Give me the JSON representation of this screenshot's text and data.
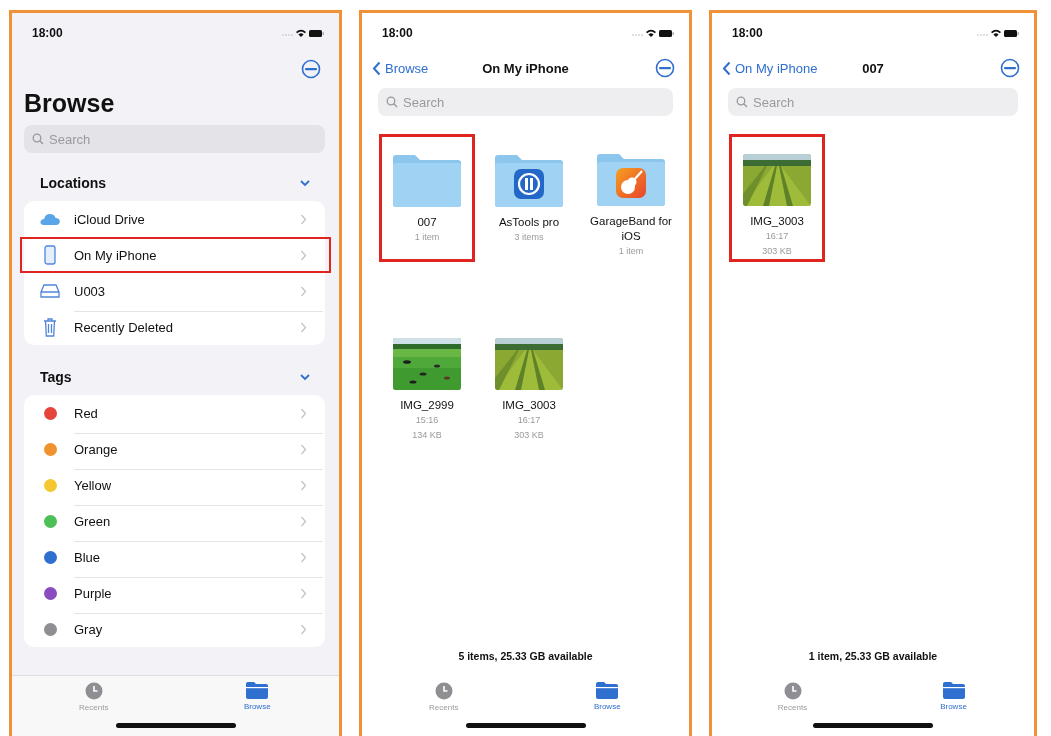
{
  "screens": [
    {
      "kind": "browse",
      "status_bar": {
        "time": "18:00"
      },
      "title": "Browse",
      "search": {
        "placeholder": "Search"
      },
      "sections": [
        {
          "title": "Locations",
          "expanded": true,
          "items": [
            {
              "kind": "cloud",
              "label": "iCloud Drive",
              "highlighted": false
            },
            {
              "kind": "phone",
              "label": "On My iPhone",
              "highlighted": true
            },
            {
              "kind": "drive",
              "label": "U003",
              "highlighted": false
            },
            {
              "kind": "trash",
              "label": "Recently Deleted",
              "highlighted": false
            }
          ]
        },
        {
          "title": "Tags",
          "expanded": true,
          "items": [
            {
              "kind": "tag",
              "label": "Red",
              "color": "#e5443a",
              "highlighted": false
            },
            {
              "kind": "tag",
              "label": "Orange",
              "color": "#f0922e",
              "highlighted": false
            },
            {
              "kind": "tag",
              "label": "Yellow",
              "color": "#f5c831",
              "highlighted": false
            },
            {
              "kind": "tag",
              "label": "Green",
              "color": "#4cbf57",
              "highlighted": false
            },
            {
              "kind": "tag",
              "label": "Blue",
              "color": "#2f6fd0",
              "highlighted": false
            },
            {
              "kind": "tag",
              "label": "Purple",
              "color": "#8a4cbf",
              "highlighted": false
            },
            {
              "kind": "tag",
              "label": "Gray",
              "color": "#8e8e93",
              "highlighted": false
            }
          ]
        }
      ],
      "tab_bar": [
        {
          "label": "Recents",
          "selected": false
        },
        {
          "label": "Browse",
          "selected": true
        }
      ]
    },
    {
      "kind": "folder",
      "status_bar": {
        "time": "18:00"
      },
      "nav": {
        "back": "Browse",
        "title": "On My iPhone"
      },
      "search": {
        "placeholder": "Search"
      },
      "items": [
        {
          "kind": "folder",
          "name": "007",
          "meta": [
            "1 item"
          ],
          "highlighted": true
        },
        {
          "kind": "tool-app-folder",
          "name": "AsTools pro",
          "meta": [
            "3 items"
          ],
          "highlighted": false
        },
        {
          "kind": "guitar-app-folder",
          "name": "GarageBand for iOS",
          "meta": [
            "1 item"
          ],
          "highlighted": false
        },
        {
          "name": "IMG_2999",
          "meta": [
            "15:16",
            "134 KB"
          ],
          "highlighted": false
        },
        {
          "name": "IMG_3003",
          "meta": [
            "16:17",
            "303 KB"
          ],
          "highlighted": false
        }
      ],
      "footer": "5 items, 25.33 GB available",
      "tab_bar": [
        {
          "label": "Recents",
          "selected": false
        },
        {
          "label": "Browse",
          "selected": true
        }
      ]
    },
    {
      "kind": "folder",
      "status_bar": {
        "time": "18:00"
      },
      "nav": {
        "back": "On My iPhone",
        "title": "007"
      },
      "search": {
        "placeholder": "Search"
      },
      "items": [
        {
          "name": "IMG_3003",
          "meta": [
            "16:17",
            "303 KB"
          ],
          "highlighted": true
        }
      ],
      "footer": "1 item, 25.33 GB available",
      "tab_bar": [
        {
          "label": "Recents",
          "selected": false
        },
        {
          "label": "Browse",
          "selected": true
        }
      ]
    }
  ]
}
